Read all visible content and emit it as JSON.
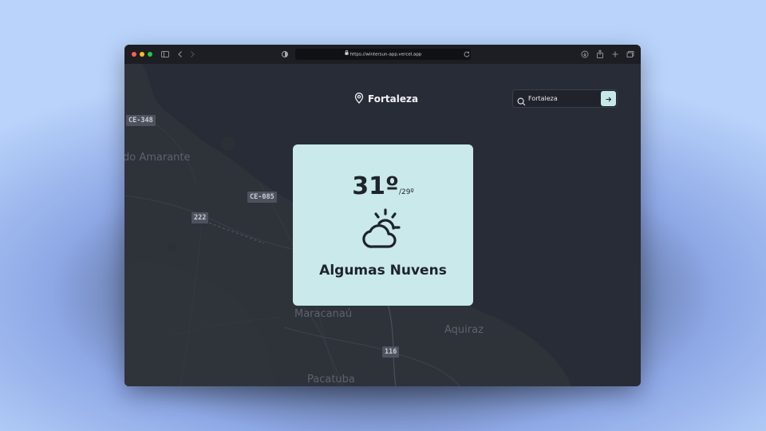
{
  "browser": {
    "url": "https://wintersun-app.vercel.app",
    "icons": [
      "sidebar-icon",
      "back-icon",
      "forward-icon",
      "shield-icon",
      "lock-icon",
      "reload-icon",
      "download-icon",
      "share-icon",
      "new-tab-icon",
      "tabs-overview-icon"
    ]
  },
  "map": {
    "labels": {
      "amarante": "do Amarante",
      "maracanau": "Maracanaú",
      "aquiraz": "Aquiraz",
      "pacatuba": "Pacatuba"
    },
    "shields": {
      "ce348": "CE-348",
      "ce085": "CE-085",
      "r222": "222",
      "r116": "116"
    }
  },
  "header": {
    "city": "Fortaleza",
    "icon": "map-pin-icon"
  },
  "search": {
    "value": "Fortaleza",
    "icon": "search-icon",
    "button_icon": "arrow-right-icon"
  },
  "weather": {
    "temperature": "31º",
    "min_temperature": "/29º",
    "description": "Algumas Nuvens",
    "icon": "partly-cloudy-icon"
  },
  "colors": {
    "card": "#c9e9ea",
    "map_background": "#282c36",
    "accent_button": "#c7e8e9"
  }
}
